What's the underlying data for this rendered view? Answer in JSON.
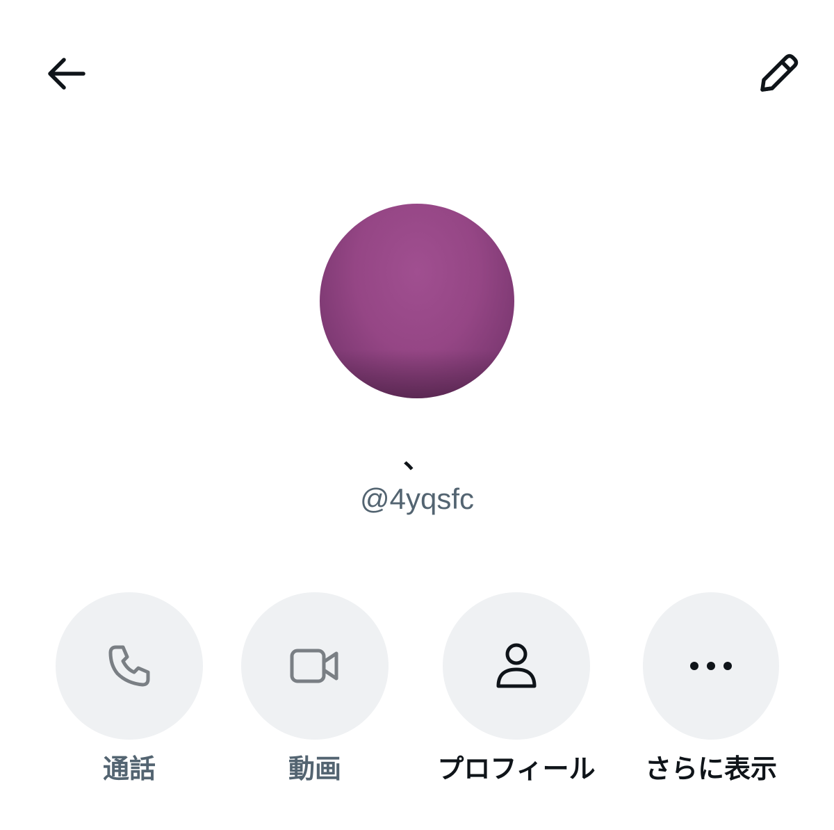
{
  "header": {
    "back_icon": "arrow-left-icon",
    "edit_icon": "pencil-icon"
  },
  "profile": {
    "display_name": "、",
    "handle": "@4yqsfc",
    "avatar_color": "#954685"
  },
  "actions": [
    {
      "label": "通話",
      "icon": "phone-icon",
      "enabled": false
    },
    {
      "label": "動画",
      "icon": "video-camera-icon",
      "enabled": false
    },
    {
      "label": "プロフィール",
      "icon": "person-icon",
      "enabled": true
    },
    {
      "label": "さらに表示",
      "icon": "more-dots-icon",
      "enabled": true
    }
  ],
  "colors": {
    "text_primary": "#0f1419",
    "text_secondary": "#536471",
    "button_bg": "#eff1f3",
    "disabled_icon": "#7a7f84"
  }
}
